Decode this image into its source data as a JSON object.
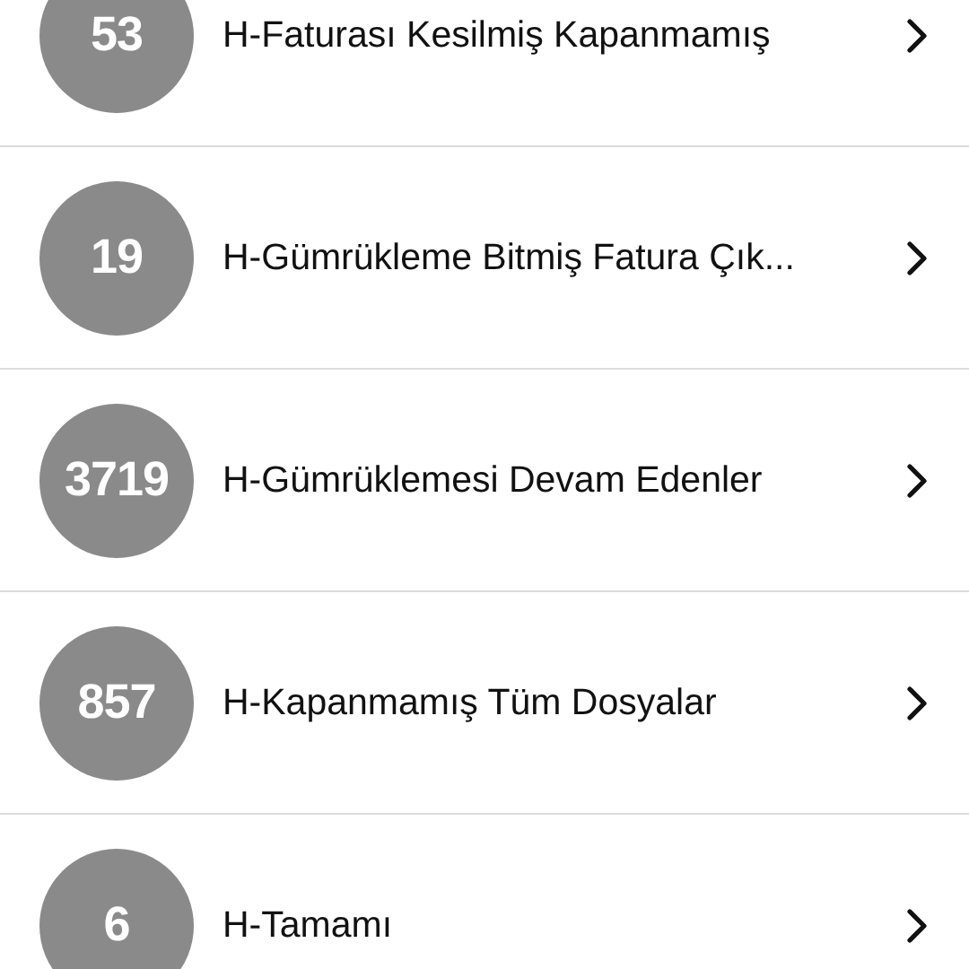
{
  "rows": [
    {
      "count": "53",
      "label": "H-Faturası Kesilmiş Kapanmamış"
    },
    {
      "count": "19",
      "label": "H-Gümrükleme Bitmiş Fatura Çık..."
    },
    {
      "count": "3719",
      "label": "H-Gümrüklemesi Devam Edenler"
    },
    {
      "count": "857",
      "label": "H-Kapanmamış Tüm Dosyalar"
    },
    {
      "count": "6",
      "label": "H-Tamamı"
    }
  ]
}
